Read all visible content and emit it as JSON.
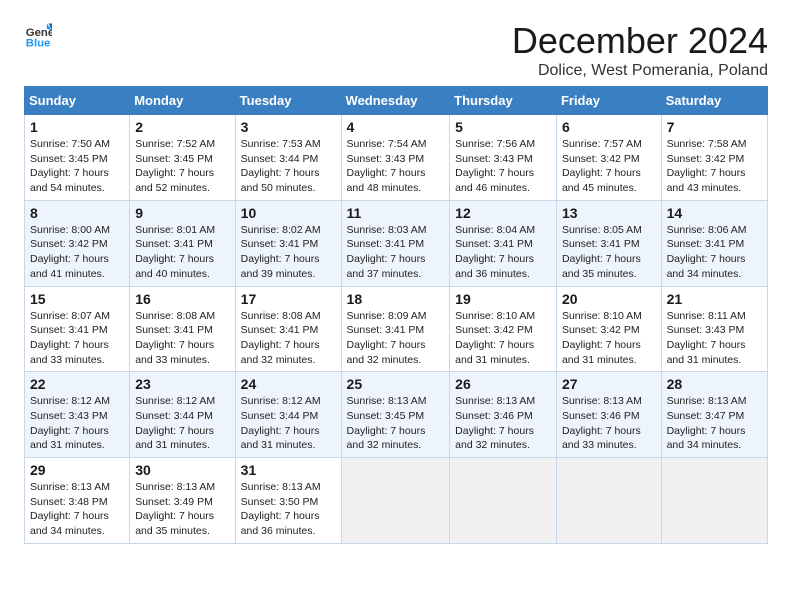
{
  "logo": {
    "line1": "General",
    "line2": "Blue"
  },
  "title": "December 2024",
  "subtitle": "Dolice, West Pomerania, Poland",
  "days_header": [
    "Sunday",
    "Monday",
    "Tuesday",
    "Wednesday",
    "Thursday",
    "Friday",
    "Saturday"
  ],
  "weeks": [
    [
      {
        "day": "1",
        "sunrise": "Sunrise: 7:50 AM",
        "sunset": "Sunset: 3:45 PM",
        "daylight": "Daylight: 7 hours and 54 minutes."
      },
      {
        "day": "2",
        "sunrise": "Sunrise: 7:52 AM",
        "sunset": "Sunset: 3:45 PM",
        "daylight": "Daylight: 7 hours and 52 minutes."
      },
      {
        "day": "3",
        "sunrise": "Sunrise: 7:53 AM",
        "sunset": "Sunset: 3:44 PM",
        "daylight": "Daylight: 7 hours and 50 minutes."
      },
      {
        "day": "4",
        "sunrise": "Sunrise: 7:54 AM",
        "sunset": "Sunset: 3:43 PM",
        "daylight": "Daylight: 7 hours and 48 minutes."
      },
      {
        "day": "5",
        "sunrise": "Sunrise: 7:56 AM",
        "sunset": "Sunset: 3:43 PM",
        "daylight": "Daylight: 7 hours and 46 minutes."
      },
      {
        "day": "6",
        "sunrise": "Sunrise: 7:57 AM",
        "sunset": "Sunset: 3:42 PM",
        "daylight": "Daylight: 7 hours and 45 minutes."
      },
      {
        "day": "7",
        "sunrise": "Sunrise: 7:58 AM",
        "sunset": "Sunset: 3:42 PM",
        "daylight": "Daylight: 7 hours and 43 minutes."
      }
    ],
    [
      {
        "day": "8",
        "sunrise": "Sunrise: 8:00 AM",
        "sunset": "Sunset: 3:42 PM",
        "daylight": "Daylight: 7 hours and 41 minutes."
      },
      {
        "day": "9",
        "sunrise": "Sunrise: 8:01 AM",
        "sunset": "Sunset: 3:41 PM",
        "daylight": "Daylight: 7 hours and 40 minutes."
      },
      {
        "day": "10",
        "sunrise": "Sunrise: 8:02 AM",
        "sunset": "Sunset: 3:41 PM",
        "daylight": "Daylight: 7 hours and 39 minutes."
      },
      {
        "day": "11",
        "sunrise": "Sunrise: 8:03 AM",
        "sunset": "Sunset: 3:41 PM",
        "daylight": "Daylight: 7 hours and 37 minutes."
      },
      {
        "day": "12",
        "sunrise": "Sunrise: 8:04 AM",
        "sunset": "Sunset: 3:41 PM",
        "daylight": "Daylight: 7 hours and 36 minutes."
      },
      {
        "day": "13",
        "sunrise": "Sunrise: 8:05 AM",
        "sunset": "Sunset: 3:41 PM",
        "daylight": "Daylight: 7 hours and 35 minutes."
      },
      {
        "day": "14",
        "sunrise": "Sunrise: 8:06 AM",
        "sunset": "Sunset: 3:41 PM",
        "daylight": "Daylight: 7 hours and 34 minutes."
      }
    ],
    [
      {
        "day": "15",
        "sunrise": "Sunrise: 8:07 AM",
        "sunset": "Sunset: 3:41 PM",
        "daylight": "Daylight: 7 hours and 33 minutes."
      },
      {
        "day": "16",
        "sunrise": "Sunrise: 8:08 AM",
        "sunset": "Sunset: 3:41 PM",
        "daylight": "Daylight: 7 hours and 33 minutes."
      },
      {
        "day": "17",
        "sunrise": "Sunrise: 8:08 AM",
        "sunset": "Sunset: 3:41 PM",
        "daylight": "Daylight: 7 hours and 32 minutes."
      },
      {
        "day": "18",
        "sunrise": "Sunrise: 8:09 AM",
        "sunset": "Sunset: 3:41 PM",
        "daylight": "Daylight: 7 hours and 32 minutes."
      },
      {
        "day": "19",
        "sunrise": "Sunrise: 8:10 AM",
        "sunset": "Sunset: 3:42 PM",
        "daylight": "Daylight: 7 hours and 31 minutes."
      },
      {
        "day": "20",
        "sunrise": "Sunrise: 8:10 AM",
        "sunset": "Sunset: 3:42 PM",
        "daylight": "Daylight: 7 hours and 31 minutes."
      },
      {
        "day": "21",
        "sunrise": "Sunrise: 8:11 AM",
        "sunset": "Sunset: 3:43 PM",
        "daylight": "Daylight: 7 hours and 31 minutes."
      }
    ],
    [
      {
        "day": "22",
        "sunrise": "Sunrise: 8:12 AM",
        "sunset": "Sunset: 3:43 PM",
        "daylight": "Daylight: 7 hours and 31 minutes."
      },
      {
        "day": "23",
        "sunrise": "Sunrise: 8:12 AM",
        "sunset": "Sunset: 3:44 PM",
        "daylight": "Daylight: 7 hours and 31 minutes."
      },
      {
        "day": "24",
        "sunrise": "Sunrise: 8:12 AM",
        "sunset": "Sunset: 3:44 PM",
        "daylight": "Daylight: 7 hours and 31 minutes."
      },
      {
        "day": "25",
        "sunrise": "Sunrise: 8:13 AM",
        "sunset": "Sunset: 3:45 PM",
        "daylight": "Daylight: 7 hours and 32 minutes."
      },
      {
        "day": "26",
        "sunrise": "Sunrise: 8:13 AM",
        "sunset": "Sunset: 3:46 PM",
        "daylight": "Daylight: 7 hours and 32 minutes."
      },
      {
        "day": "27",
        "sunrise": "Sunrise: 8:13 AM",
        "sunset": "Sunset: 3:46 PM",
        "daylight": "Daylight: 7 hours and 33 minutes."
      },
      {
        "day": "28",
        "sunrise": "Sunrise: 8:13 AM",
        "sunset": "Sunset: 3:47 PM",
        "daylight": "Daylight: 7 hours and 34 minutes."
      }
    ],
    [
      {
        "day": "29",
        "sunrise": "Sunrise: 8:13 AM",
        "sunset": "Sunset: 3:48 PM",
        "daylight": "Daylight: 7 hours and 34 minutes."
      },
      {
        "day": "30",
        "sunrise": "Sunrise: 8:13 AM",
        "sunset": "Sunset: 3:49 PM",
        "daylight": "Daylight: 7 hours and 35 minutes."
      },
      {
        "day": "31",
        "sunrise": "Sunrise: 8:13 AM",
        "sunset": "Sunset: 3:50 PM",
        "daylight": "Daylight: 7 hours and 36 minutes."
      },
      null,
      null,
      null,
      null
    ]
  ]
}
